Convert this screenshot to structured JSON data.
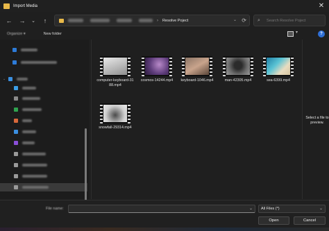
{
  "window": {
    "title": "Import Media",
    "close_glyph": "✕"
  },
  "nav": {
    "back": "←",
    "forward": "→",
    "recent": "⌄",
    "up": "↑"
  },
  "breadcrumb": {
    "current": "Resolve Poject",
    "separator": "›"
  },
  "search": {
    "placeholder": "Search Resolve Poject"
  },
  "toolbar": {
    "organize_label": "Organize ▾",
    "new_folder_label": "New folder"
  },
  "sidebar": {
    "items": [
      {
        "icon": "cloud-icon",
        "color": "#2d7bd8"
      },
      {
        "icon": "cloud-icon",
        "color": "#2d7bd8"
      },
      {
        "icon": "pc-icon",
        "color": "#3b8fe0"
      },
      {
        "icon": "desktop-icon",
        "color": "#3b9fe8"
      },
      {
        "icon": "documents-icon",
        "color": "#8a8a8a"
      },
      {
        "icon": "downloads-icon",
        "color": "#2fa34f"
      },
      {
        "icon": "music-icon",
        "color": "#d8683b"
      },
      {
        "icon": "pictures-icon",
        "color": "#3b8fe0"
      },
      {
        "icon": "videos-icon",
        "color": "#8a4fd8"
      },
      {
        "icon": "drive-icon",
        "color": "#9a9a9a"
      },
      {
        "icon": "drive-icon",
        "color": "#9a9a9a"
      },
      {
        "icon": "drive-icon",
        "color": "#9a9a9a"
      },
      {
        "icon": "drive-icon",
        "color": "#9a9a9a"
      }
    ]
  },
  "files": [
    {
      "name": "computer-keyboard-3188.mp4"
    },
    {
      "name": "cosmos-14244.mp4"
    },
    {
      "name": "keyboard-1046.mp4"
    },
    {
      "name": "man-42305.mp4"
    },
    {
      "name": "sea-6399.mp4"
    },
    {
      "name": "snowfall-29314.mp4"
    }
  ],
  "preview": {
    "message": "Select a file to preview."
  },
  "footer": {
    "file_name_label": "File name:",
    "file_name_value": "",
    "file_type": "All Files (*)",
    "open_label": "Open",
    "cancel_label": "Cancel"
  },
  "colors": {
    "accent": "#2f6fd6",
    "background": "#1f1f1f"
  }
}
